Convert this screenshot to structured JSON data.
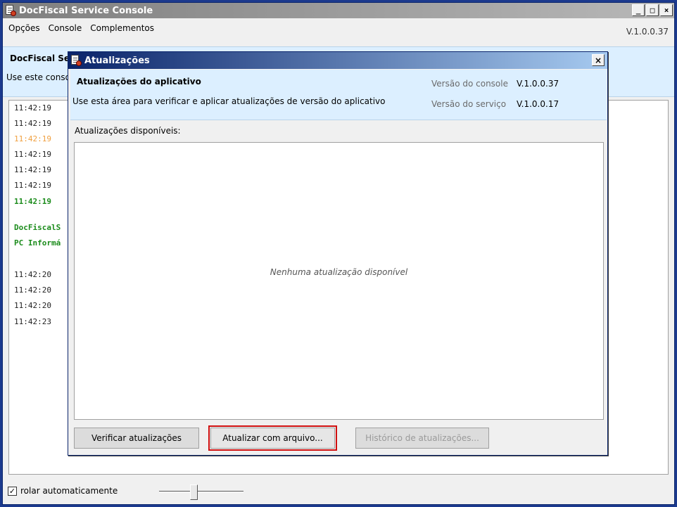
{
  "main": {
    "title": "DocFiscal Service Console",
    "menu": [
      "Opções",
      "Console",
      "Complementos"
    ],
    "version": "V.1.0.0.37",
    "header_title": "DocFiscal Se",
    "header_desc": "Use este consol",
    "controls": {
      "minimize": "_",
      "maximize": "□",
      "close": "×"
    }
  },
  "log": [
    {
      "text": "11:42:19",
      "style": "normal"
    },
    {
      "text": "11:42:19",
      "style": "normal"
    },
    {
      "text": "11:42:19",
      "style": "orange"
    },
    {
      "text": "11:42:19",
      "style": "normal"
    },
    {
      "text": "11:42:19",
      "style": "normal"
    },
    {
      "text": "11:42:19",
      "style": "normal"
    },
    {
      "text": "11:42:19",
      "style": "green"
    },
    {
      "text": "DocFiscalS",
      "style": "green"
    },
    {
      "text": "PC Informá",
      "style": "green"
    },
    {
      "text": "11:42:20",
      "style": "normal"
    },
    {
      "text": "11:42:20",
      "style": "normal"
    },
    {
      "text": "11:42:20",
      "style": "normal"
    },
    {
      "text": "11:42:23",
      "style": "normal"
    }
  ],
  "footer": {
    "autoscroll_label": "rolar automaticamente",
    "autoscroll_checked": true,
    "check_mark": "✓"
  },
  "dialog": {
    "title": "Atualizações",
    "close": "×",
    "header_title": "Atualizações do aplicativo",
    "header_desc": "Use esta área para verificar e aplicar atualizações de versão do aplicativo",
    "console_version_label": "Versão do console",
    "console_version": "V.1.0.0.37",
    "service_version_label": "Versão do serviço",
    "service_version": "V.1.0.0.17",
    "list_label": "Atualizações disponíveis:",
    "empty_text": "Nenhuma atualização disponível",
    "buttons": {
      "check": "Verificar atualizações",
      "from_file": "Atualizar com arquivo...",
      "history": "Histórico de atualizações..."
    },
    "highlight_color": "#d01010"
  }
}
